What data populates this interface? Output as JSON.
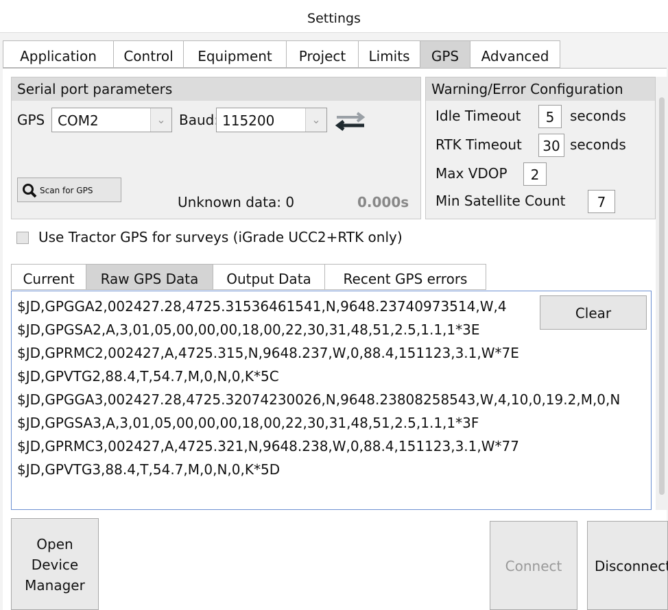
{
  "window": {
    "title": "Settings"
  },
  "tabs": [
    {
      "label": "Application"
    },
    {
      "label": "Control"
    },
    {
      "label": "Equipment"
    },
    {
      "label": "Project"
    },
    {
      "label": "Limits"
    },
    {
      "label": "GPS"
    },
    {
      "label": "Advanced"
    }
  ],
  "serial": {
    "header": "Serial port parameters",
    "gps_label": "GPS",
    "gps_port": "COM2",
    "baud_label": "Baud:",
    "baud_value": "115200",
    "scan_label": "Scan for GPS",
    "unknown_data": "Unknown data: 0",
    "rate": "0.000s"
  },
  "warn": {
    "header": "Warning/Error Configuration",
    "idle_label": "Idle Timeout",
    "idle_value": "5",
    "idle_unit": "seconds",
    "rtk_label": "RTK Timeout",
    "rtk_value": "30",
    "rtk_unit": "seconds",
    "vdop_label": "Max VDOP",
    "vdop_value": "2",
    "minsat_label": "Min Satellite Count",
    "minsat_value": "7"
  },
  "use_tractor_gps": "Use Tractor GPS for surveys (iGrade UCC2+RTK only)",
  "subtabs": [
    {
      "label": "Current"
    },
    {
      "label": "Raw GPS Data"
    },
    {
      "label": "Output Data"
    },
    {
      "label": "Recent GPS errors"
    }
  ],
  "log": {
    "lines": [
      "$JD,GPGGA2,002427.28,4725.31536461541,N,9648.23740973514,W,4",
      "$JD,GPGSA2,A,3,01,05,00,00,00,18,00,22,30,31,48,51,2.5,1.1,1*3E",
      "$JD,GPRMC2,002427,A,4725.315,N,9648.237,W,0,88.4,151123,3.1,W*7E",
      "$JD,GPVTG2,88.4,T,54.7,M,0,N,0,K*5C",
      "$JD,GPGGA3,002427.28,4725.32074230026,N,9648.23808258543,W,4,10,0,19.2,M,0,N",
      "$JD,GPGSA3,A,3,01,05,00,00,00,18,00,22,30,31,48,51,2.5,1.1,1*3F",
      "$JD,GPRMC3,002427,A,4725.321,N,9648.238,W,0,88.4,151123,3.1,W*77",
      "$JD,GPVTG3,88.4,T,54.7,M,0,N,0,K*5D"
    ],
    "clear_label": "Clear"
  },
  "bottom": {
    "open_device_manager": "Open Device Manager",
    "connect": "Connect",
    "disconnect": "Disconnect"
  },
  "icons": {
    "swap": "swap-arrows-icon",
    "search": "search-icon",
    "chevron": "chevron-down-icon"
  }
}
